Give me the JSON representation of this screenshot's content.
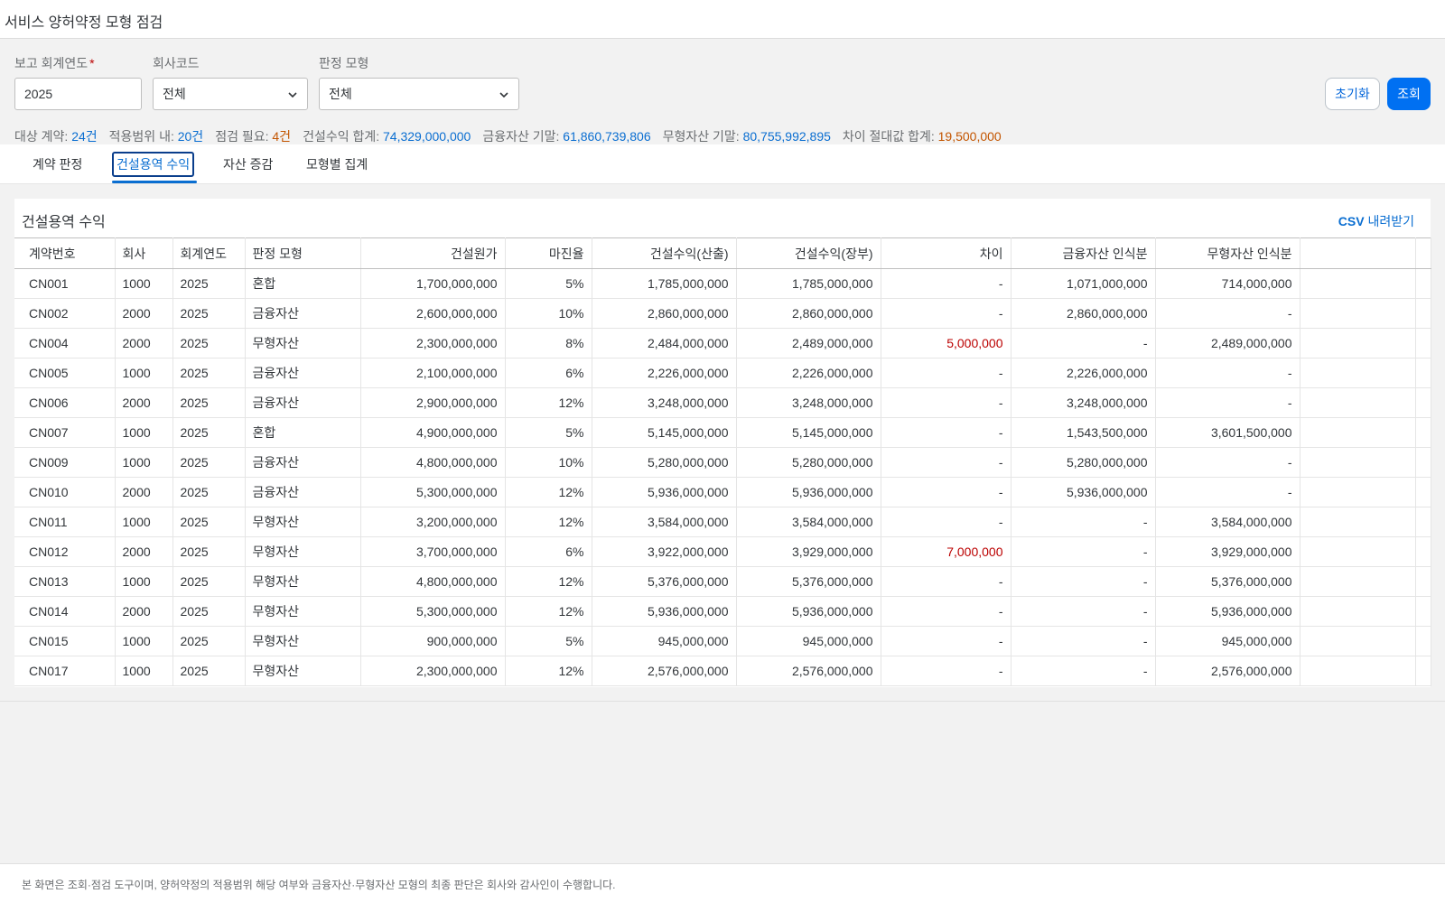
{
  "app": {
    "title": "서비스 양허약정 모형 점검"
  },
  "filters": {
    "year": {
      "label": "보고 회계연도",
      "required_mark": "*",
      "value": "2025"
    },
    "company": {
      "label": "회사코드",
      "value": "전체"
    },
    "model": {
      "label": "판정 모형",
      "value": "전체"
    },
    "reset_label": "초기화",
    "search_label": "조회"
  },
  "stats": [
    {
      "label": "대상 계약: ",
      "value": "24건",
      "tone": "v"
    },
    {
      "label": "적용범위 내: ",
      "value": "20건",
      "tone": "v"
    },
    {
      "label": "점검 필요: ",
      "value": "4건",
      "tone": "w"
    },
    {
      "label": "건설수익 합계: ",
      "value": "74,329,000,000",
      "tone": "v"
    },
    {
      "label": "금융자산 기말: ",
      "value": "61,860,739,806",
      "tone": "v"
    },
    {
      "label": "무형자산 기말: ",
      "value": "80,755,992,895",
      "tone": "v"
    },
    {
      "label": "차이 절대값 합계: ",
      "value": "19,500,000",
      "tone": "w"
    }
  ],
  "tabs": [
    {
      "label": "계약 판정"
    },
    {
      "label": "건설용역 수익",
      "active": true
    },
    {
      "label": "자산 증감"
    },
    {
      "label": "모형별 집계"
    }
  ],
  "panel": {
    "title": "건설용역 수익",
    "csv_prefix": "CSV",
    "csv_label": " 내려받기"
  },
  "table": {
    "columns": [
      "계약번호",
      "회사",
      "회계연도",
      "판정 모형",
      "건설원가",
      "마진율",
      "건설수익(산출)",
      "건설수익(장부)",
      "차이",
      "금융자산 인식분",
      "무형자산 인식분"
    ],
    "rows": [
      [
        "CN001",
        "1000",
        "2025",
        "혼합",
        "1,700,000,000",
        "5%",
        "1,785,000,000",
        "1,785,000,000",
        "-",
        "1,071,000,000",
        "714,000,000"
      ],
      [
        "CN002",
        "2000",
        "2025",
        "금융자산",
        "2,600,000,000",
        "10%",
        "2,860,000,000",
        "2,860,000,000",
        "-",
        "2,860,000,000",
        "-"
      ],
      [
        "CN004",
        "2000",
        "2025",
        "무형자산",
        "2,300,000,000",
        "8%",
        "2,484,000,000",
        "2,489,000,000",
        "5,000,000",
        "-",
        "2,489,000,000"
      ],
      [
        "CN005",
        "1000",
        "2025",
        "금융자산",
        "2,100,000,000",
        "6%",
        "2,226,000,000",
        "2,226,000,000",
        "-",
        "2,226,000,000",
        "-"
      ],
      [
        "CN006",
        "2000",
        "2025",
        "금융자산",
        "2,900,000,000",
        "12%",
        "3,248,000,000",
        "3,248,000,000",
        "-",
        "3,248,000,000",
        "-"
      ],
      [
        "CN007",
        "1000",
        "2025",
        "혼합",
        "4,900,000,000",
        "5%",
        "5,145,000,000",
        "5,145,000,000",
        "-",
        "1,543,500,000",
        "3,601,500,000"
      ],
      [
        "CN009",
        "1000",
        "2025",
        "금융자산",
        "4,800,000,000",
        "10%",
        "5,280,000,000",
        "5,280,000,000",
        "-",
        "5,280,000,000",
        "-"
      ],
      [
        "CN010",
        "2000",
        "2025",
        "금융자산",
        "5,300,000,000",
        "12%",
        "5,936,000,000",
        "5,936,000,000",
        "-",
        "5,936,000,000",
        "-"
      ],
      [
        "CN011",
        "1000",
        "2025",
        "무형자산",
        "3,200,000,000",
        "12%",
        "3,584,000,000",
        "3,584,000,000",
        "-",
        "-",
        "3,584,000,000"
      ],
      [
        "CN012",
        "2000",
        "2025",
        "무형자산",
        "3,700,000,000",
        "6%",
        "3,922,000,000",
        "3,929,000,000",
        "7,000,000",
        "-",
        "3,929,000,000"
      ],
      [
        "CN013",
        "1000",
        "2025",
        "무형자산",
        "4,800,000,000",
        "12%",
        "5,376,000,000",
        "5,376,000,000",
        "-",
        "-",
        "5,376,000,000"
      ],
      [
        "CN014",
        "2000",
        "2025",
        "무형자산",
        "5,300,000,000",
        "12%",
        "5,936,000,000",
        "5,936,000,000",
        "-",
        "-",
        "5,936,000,000"
      ],
      [
        "CN015",
        "1000",
        "2025",
        "무형자산",
        "900,000,000",
        "5%",
        "945,000,000",
        "945,000,000",
        "-",
        "-",
        "945,000,000"
      ],
      [
        "CN017",
        "1000",
        "2025",
        "무형자산",
        "2,300,000,000",
        "12%",
        "2,576,000,000",
        "2,576,000,000",
        "-",
        "-",
        "2,576,000,000"
      ]
    ]
  },
  "footer": {
    "note": "본 화면은 조회·점검 도구이며, 양허약정의 적용범위 해당 여부와 금융자산·무형자산 모형의 최종 판단은 회사와 감사인이 수행합니다."
  },
  "colors": {
    "accent": "#0a6ed1",
    "primary_button": "#0070f2",
    "warning": "#c35500",
    "error": "#bb0000"
  },
  "icons": {
    "select_arrow": "chevron-down-icon"
  }
}
